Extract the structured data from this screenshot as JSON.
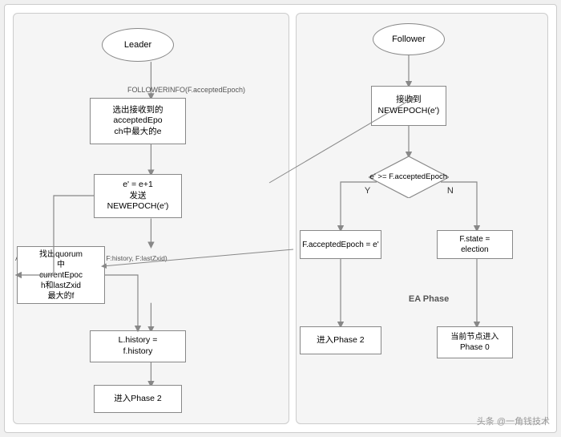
{
  "left": {
    "leader_label": "Leader",
    "node1_label": "选出接收到的\nacceptedEpo\nch中最大的e",
    "node2_label": "e' = e+1\n发送\nNEWEPOCH(e')",
    "node3_label": "找出quorum\n中\ncurrentEpoc\nh和lastZxid\n最大的f",
    "node4_label": "L.history =\nf.history",
    "node5_label": "进入Phase 2",
    "ack_label": "ACKEPOCH(F:currentEpoch, F:history, F:lastZxid)",
    "follower_info_label": "FOLLOWERINFO(F.acceptedEpoch)"
  },
  "right": {
    "follower_label": "Follower",
    "node1_label": "接收到\nNEWEPOCH(e')",
    "diamond_label": "e' >= F.acceptedEpoch",
    "y_label": "Y",
    "n_label": "N",
    "node_yes_label": "F.acceptedEpoch = e'",
    "node_no_label": "F.state =\nelection",
    "node_phase2_label": "进入Phase 2",
    "node_phase0_label": "当前节点进入\nPhase 0",
    "ea_phase_label": "EA Phase"
  },
  "watermark": "头条 @一角钱技术"
}
